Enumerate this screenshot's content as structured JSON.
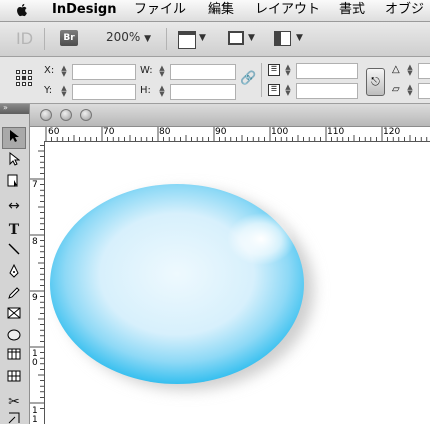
{
  "menubar": {
    "app_name": "InDesign",
    "items": [
      "ファイル",
      "編集",
      "レイアウト",
      "書式",
      "オブジ"
    ]
  },
  "appbar": {
    "app_logo": "ID",
    "bridge_label": "Br",
    "zoom": "200%"
  },
  "control": {
    "x_label": "X:",
    "y_label": "Y:",
    "w_label": "W:",
    "h_label": "H:"
  },
  "rulers": {
    "horizontal": [
      "60",
      "70",
      "80",
      "90",
      "100",
      "110",
      "120"
    ],
    "vertical": [
      "7",
      "8",
      "9",
      "10",
      "11"
    ]
  },
  "canvas": {
    "shape": "ellipse",
    "fill_colors": {
      "edge": "#35BFEF",
      "center": "#EAF7FD",
      "highlight": "#FFFFFF"
    }
  },
  "icons": {
    "apple": "apple-icon",
    "selection": "selection-tool-icon",
    "direct_selection": "direct-selection-tool-icon",
    "page": "page-tool-icon",
    "gap": "gap-tool-icon",
    "type": "type-tool-icon",
    "line": "line-tool-icon",
    "pen": "pen-tool-icon",
    "pencil": "pencil-tool-icon",
    "rect_frame": "rectangle-frame-tool-icon",
    "ellipse": "ellipse-tool-icon",
    "table": "table-icon",
    "scissors": "scissors-tool-icon"
  }
}
